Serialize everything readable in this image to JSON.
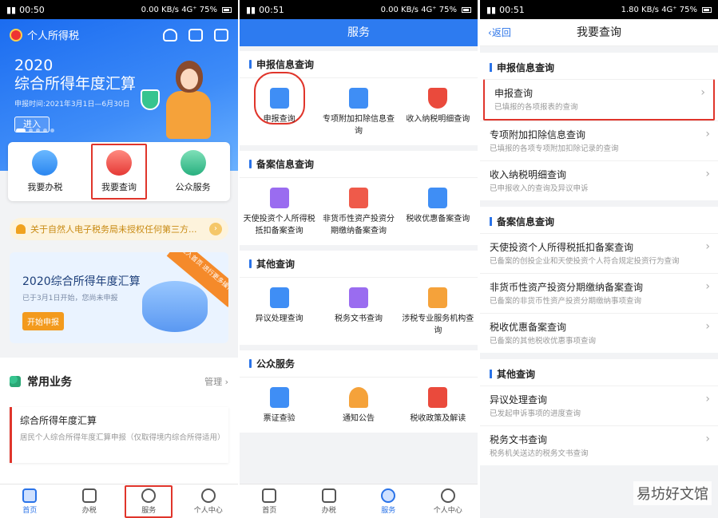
{
  "p1": {
    "status": {
      "left": "4G 4G",
      "time": "00:50",
      "right": "0.00 KB/s 4G⁺ 75%"
    },
    "app_title": "个人所得税",
    "hero": {
      "year": "2020",
      "title": "综合所得年度汇算",
      "date": "申报时间:2021年3月1日—6月30日",
      "enter": "进入"
    },
    "quick": [
      {
        "label": "我要办税"
      },
      {
        "label": "我要查询"
      },
      {
        "label": "公众服务"
      }
    ],
    "notice": "关于自然人电子税务局未授权任何第三方...",
    "promo": {
      "title": "2020综合所得年度汇算",
      "sub": "已于3月1日开始，您尚未申报",
      "btn": "开始申报",
      "ribbon": "进入首页 进行更多操作"
    },
    "common": {
      "title": "常用业务",
      "manage": "管理",
      "card_title": "综合所得年度汇算",
      "card_desc": "居民个人综合所得年度汇算申报（仅取得境内综合所得适用）"
    },
    "tabs": [
      "首页",
      "办税",
      "服务",
      "个人中心"
    ]
  },
  "p2": {
    "status": {
      "time": "00:51",
      "right": "0.00 KB/s 4G⁺ 75%"
    },
    "nav_title": "服务",
    "sections": [
      {
        "title": "申报信息查询",
        "items": [
          "申报查询",
          "专项附加扣除信息查询",
          "收入纳税明细查询"
        ]
      },
      {
        "title": "备案信息查询",
        "items": [
          "天使投资个人所得税抵扣备案查询",
          "非货币性资产投资分期缴纳备案查询",
          "税收优惠备案查询"
        ]
      },
      {
        "title": "其他查询",
        "items": [
          "异议处理查询",
          "税务文书查询",
          "涉税专业服务机构查询"
        ]
      },
      {
        "title": "公众服务",
        "items": [
          "票证查验",
          "通知公告",
          "税收政策及解读"
        ]
      }
    ],
    "tabs": [
      "首页",
      "办税",
      "服务",
      "个人中心"
    ]
  },
  "p3": {
    "status": {
      "time": "00:51",
      "right": "1.80 KB/s 4G⁺ 75%"
    },
    "back": "返回",
    "nav_title": "我要查询",
    "sections": [
      {
        "title": "申报信息查询",
        "items": [
          {
            "t": "申报查询",
            "d": "已填报的各项报表的查询"
          },
          {
            "t": "专项附加扣除信息查询",
            "d": "已填报的各项专项附加扣除记录的查询"
          },
          {
            "t": "收入纳税明细查询",
            "d": "已申报收入的查询及异议申诉"
          }
        ]
      },
      {
        "title": "备案信息查询",
        "items": [
          {
            "t": "天使投资个人所得税抵扣备案查询",
            "d": "已备案的创投企业和天使投资个人符合规定投资行为查询"
          },
          {
            "t": "非货币性资产投资分期缴纳备案查询",
            "d": "已备案的非货币性资产投资分期缴纳事项查询"
          },
          {
            "t": "税收优惠备案查询",
            "d": "已备案的其他税收优惠事项查询"
          }
        ]
      },
      {
        "title": "其他查询",
        "items": [
          {
            "t": "异议处理查询",
            "d": "已发起申诉事项的进度查询"
          },
          {
            "t": "税务文书查询",
            "d": "税务机关送达的税务文书查询"
          }
        ]
      }
    ],
    "watermark": "易坊好文馆"
  }
}
